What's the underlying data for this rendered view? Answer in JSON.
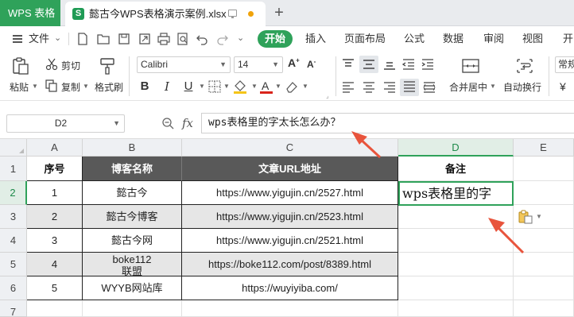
{
  "titlebar": {
    "app_tab": "WPS 表格",
    "doc_tab": "懿古今WPS表格演示案例.xlsx",
    "new_tab": "+"
  },
  "menu": {
    "file": "文件",
    "items": [
      "开始",
      "插入",
      "页面布局",
      "公式",
      "数据",
      "审阅",
      "视图",
      "开"
    ]
  },
  "ribbon": {
    "paste": "粘贴",
    "cut": "剪切",
    "copy": "复制",
    "format_painter": "格式刷",
    "font_name": "Calibri",
    "font_size": "14",
    "bold": "B",
    "italic": "I",
    "underline": "U",
    "merge_center": "合并居中",
    "wrap_text": "自动换行",
    "number_format": "常规",
    "currency": "¥"
  },
  "formula_bar": {
    "name_box": "D2",
    "fx": "fx",
    "content": "wps表格里的字太长怎么办？"
  },
  "grid": {
    "columns": [
      "A",
      "B",
      "C",
      "D",
      "E"
    ],
    "rows": [
      "1",
      "2",
      "3",
      "4",
      "5",
      "6",
      "7"
    ],
    "header": {
      "a": "序号",
      "b": "博客名称",
      "c": "文章URL地址",
      "d": "备注"
    },
    "data": [
      {
        "a": "1",
        "b": "懿古今",
        "c": "https://www.yigujin.cn/2527.html",
        "d": "wps表格里的字"
      },
      {
        "a": "2",
        "b": "懿古今博客",
        "c": "https://www.yigujin.cn/2523.html",
        "d": ""
      },
      {
        "a": "3",
        "b": "懿古今网",
        "c": "https://www.yigujin.cn/2521.html",
        "d": ""
      },
      {
        "a": "4",
        "b": "boke112",
        "b2": "联盟",
        "c": "https://boke112.com/post/8389.html",
        "d": ""
      },
      {
        "a": "5",
        "b": "WYYB网站库",
        "c": "https://wuyiyiba.com/",
        "d": ""
      }
    ]
  },
  "colors": {
    "accent": "#2fa25a",
    "header_fill": "#595959",
    "arrow": "#e8543c"
  }
}
